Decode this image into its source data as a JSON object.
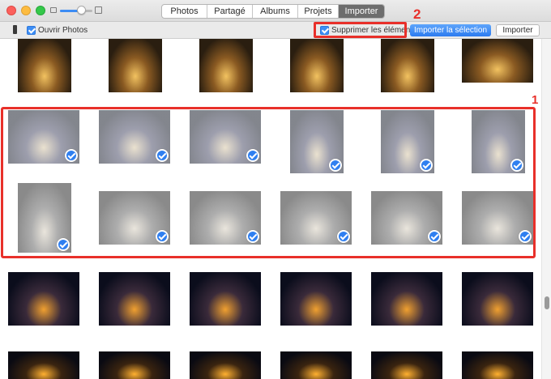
{
  "tabs": [
    {
      "label": "Photos",
      "active": false
    },
    {
      "label": "Partagé",
      "active": false
    },
    {
      "label": "Albums",
      "active": false
    },
    {
      "label": "Projets",
      "active": false
    },
    {
      "label": "Importer",
      "active": true
    }
  ],
  "toolbar": {
    "open_photos_label": "Ouvrir Photos",
    "open_photos_checked": true,
    "delete_items_label": "Supprimer les éléments",
    "delete_items_checked": true,
    "import_selection_label": "Importer la sélection",
    "import_label": "Importer"
  },
  "annotations": {
    "marker_1": "1",
    "marker_2": "2"
  },
  "colors": {
    "accent": "#2f7ff0",
    "annotation_red": "#e8302a"
  },
  "photo_rows": [
    {
      "selected": false,
      "tone": [
        "#2a1e10",
        "#8a5a22",
        "#f2c260"
      ]
    },
    {
      "selected": true,
      "tone": [
        "#1d2230",
        "#4d4f6a",
        "#d9c9a8"
      ]
    },
    {
      "selected": true,
      "tone": [
        "#2a2a2a",
        "#6a6a6a",
        "#d8d0c0"
      ]
    },
    {
      "selected": false,
      "tone": [
        "#0b0d1c",
        "#3a2a3a",
        "#f0a030"
      ]
    },
    {
      "selected": false,
      "tone": [
        "#0a0a12",
        "#3a2410",
        "#ffb030"
      ]
    }
  ]
}
